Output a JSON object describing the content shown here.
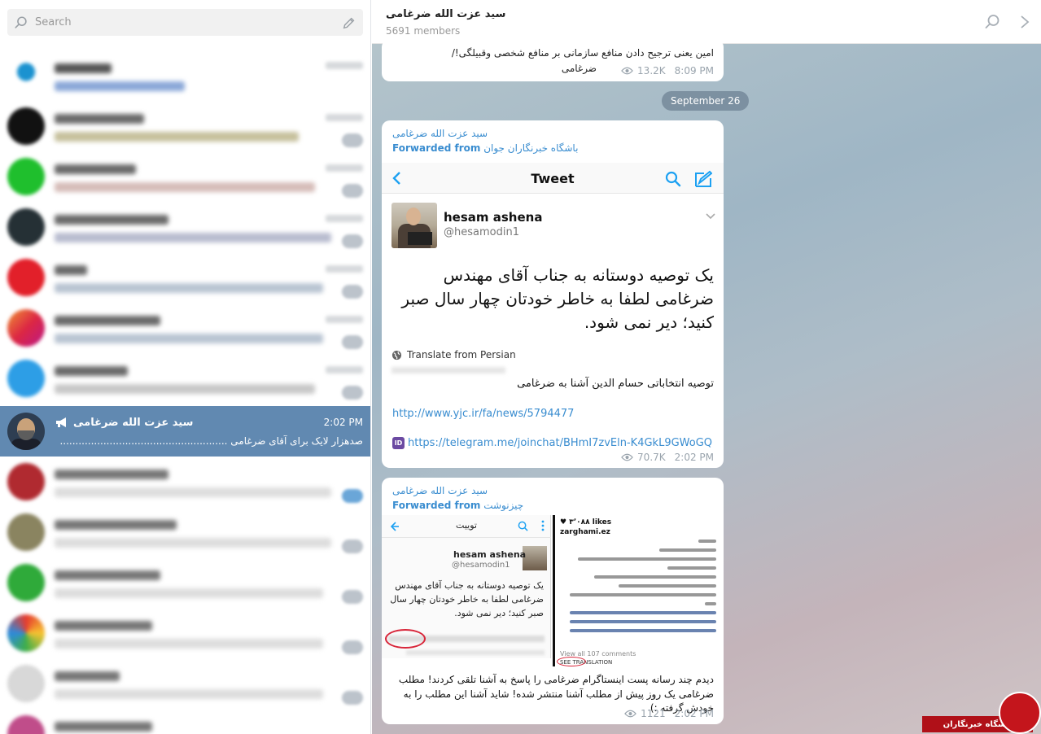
{
  "sidebar": {
    "search_placeholder": "Search",
    "active_chat": {
      "name": "سید عزت الله ضرغامی",
      "time": "2:02 PM",
      "preview": "صدهزار لایک برای آقای ضرغامی ......................................................"
    }
  },
  "header": {
    "title": "سید عزت الله ضرغامی",
    "members": "5691 members"
  },
  "messages": [
    {
      "text_line1": "امین یعنی ترجیح دادن منافع سازمانی بر منافع شخصی وقبیلگی!/",
      "text_line2": "ضرغامی",
      "views": "13.2K",
      "time": "8:09 PM"
    },
    {
      "sender": "سید عزت الله ضرغامی",
      "forwarded_label": "Forwarded from",
      "forwarded_from": "باشگاه خبرنگاران جوان",
      "tweet": {
        "bar_title": "Tweet",
        "name": "hesam ashena",
        "handle": "@hesamodin1",
        "body": "یک توصیه دوستانه به جناب آقای مهندس ضرغامی لطفا به خاطر خودتان چهار سال صبر کنید؛ دیر نمی شود.",
        "translate": "Translate from Persian"
      },
      "caption": "توصیه انتخاباتی حسام الدین آشنا به ضرغامی",
      "link1": "http://www.yjc.ir/fa/news/5794477",
      "link2": "https://telegram.me/joinchat/BHmI7zvEln-K4GkL9GWoGQ",
      "link2_badge": "ID",
      "views": "70.7K",
      "time": "2:02 PM"
    },
    {
      "sender": "سید عزت الله ضرغامی",
      "forwarded_label": "Forwarded from",
      "forwarded_from": "چیزنوشت",
      "image_left": {
        "bar_title": "توییت",
        "name": "hesam ashena",
        "handle": "@hesamodin1",
        "body": "یک توصیه دوستانه به جناب آقای مهندس ضرغامی لطفا به خاطر خودتان چهار سال صبر کنید؛ دیر نمی شود."
      },
      "image_right": {
        "likes": "♥ ۳٬۰۸۸ likes",
        "user": "zarghami.ez",
        "footer": "View all 107 comments",
        "footer2": "SEE TRANSLATION"
      },
      "caption": "دیدم چند رسانه پست اینستاگرام ضرغامی را پاسخ به آشنا تلقی کردند! مطلب ضرغامی یک روز پیش از مطلب آشنا منتشر شده! شاید آشنا این مطلب را به خودش گرفته :)",
      "views": "1121",
      "time": "2:02 PM"
    }
  ],
  "date_separator": "September 26",
  "watermark": "باشگاه خبرنگاران",
  "colors": {
    "active_row": "#6189b1",
    "link": "#3a8dd0",
    "watermark": "#c4151c"
  }
}
